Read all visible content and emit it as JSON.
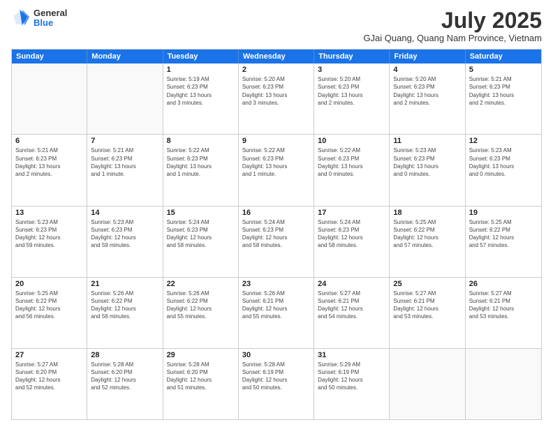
{
  "logo": {
    "general": "General",
    "blue": "Blue"
  },
  "header": {
    "title": "July 2025",
    "subtitle": "GJai Quang, Quang Nam Province, Vietnam"
  },
  "weekdays": [
    "Sunday",
    "Monday",
    "Tuesday",
    "Wednesday",
    "Thursday",
    "Friday",
    "Saturday"
  ],
  "rows": [
    [
      {
        "day": "",
        "info": ""
      },
      {
        "day": "",
        "info": ""
      },
      {
        "day": "1",
        "info": "Sunrise: 5:19 AM\nSunset: 6:23 PM\nDaylight: 13 hours\nand 3 minutes."
      },
      {
        "day": "2",
        "info": "Sunrise: 5:20 AM\nSunset: 6:23 PM\nDaylight: 13 hours\nand 3 minutes."
      },
      {
        "day": "3",
        "info": "Sunrise: 5:20 AM\nSunset: 6:23 PM\nDaylight: 13 hours\nand 2 minutes."
      },
      {
        "day": "4",
        "info": "Sunrise: 5:20 AM\nSunset: 6:23 PM\nDaylight: 13 hours\nand 2 minutes."
      },
      {
        "day": "5",
        "info": "Sunrise: 5:21 AM\nSunset: 6:23 PM\nDaylight: 13 hours\nand 2 minutes."
      }
    ],
    [
      {
        "day": "6",
        "info": "Sunrise: 5:21 AM\nSunset: 6:23 PM\nDaylight: 13 hours\nand 2 minutes."
      },
      {
        "day": "7",
        "info": "Sunrise: 5:21 AM\nSunset: 6:23 PM\nDaylight: 13 hours\nand 1 minute."
      },
      {
        "day": "8",
        "info": "Sunrise: 5:22 AM\nSunset: 6:23 PM\nDaylight: 13 hours\nand 1 minute."
      },
      {
        "day": "9",
        "info": "Sunrise: 5:22 AM\nSunset: 6:23 PM\nDaylight: 13 hours\nand 1 minute."
      },
      {
        "day": "10",
        "info": "Sunrise: 5:22 AM\nSunset: 6:23 PM\nDaylight: 13 hours\nand 0 minutes."
      },
      {
        "day": "11",
        "info": "Sunrise: 5:23 AM\nSunset: 6:23 PM\nDaylight: 13 hours\nand 0 minutes."
      },
      {
        "day": "12",
        "info": "Sunrise: 5:23 AM\nSunset: 6:23 PM\nDaylight: 13 hours\nand 0 minutes."
      }
    ],
    [
      {
        "day": "13",
        "info": "Sunrise: 5:23 AM\nSunset: 6:23 PM\nDaylight: 12 hours\nand 59 minutes."
      },
      {
        "day": "14",
        "info": "Sunrise: 5:23 AM\nSunset: 6:23 PM\nDaylight: 12 hours\nand 59 minutes."
      },
      {
        "day": "15",
        "info": "Sunrise: 5:24 AM\nSunset: 6:23 PM\nDaylight: 12 hours\nand 58 minutes."
      },
      {
        "day": "16",
        "info": "Sunrise: 5:24 AM\nSunset: 6:23 PM\nDaylight: 12 hours\nand 58 minutes."
      },
      {
        "day": "17",
        "info": "Sunrise: 5:24 AM\nSunset: 6:23 PM\nDaylight: 12 hours\nand 58 minutes."
      },
      {
        "day": "18",
        "info": "Sunrise: 5:25 AM\nSunset: 6:22 PM\nDaylight: 12 hours\nand 57 minutes."
      },
      {
        "day": "19",
        "info": "Sunrise: 5:25 AM\nSunset: 6:22 PM\nDaylight: 12 hours\nand 57 minutes."
      }
    ],
    [
      {
        "day": "20",
        "info": "Sunrise: 5:25 AM\nSunset: 6:22 PM\nDaylight: 12 hours\nand 56 minutes."
      },
      {
        "day": "21",
        "info": "Sunrise: 5:26 AM\nSunset: 6:22 PM\nDaylight: 12 hours\nand 56 minutes."
      },
      {
        "day": "22",
        "info": "Sunrise: 5:26 AM\nSunset: 6:22 PM\nDaylight: 12 hours\nand 55 minutes."
      },
      {
        "day": "23",
        "info": "Sunrise: 5:26 AM\nSunset: 6:21 PM\nDaylight: 12 hours\nand 55 minutes."
      },
      {
        "day": "24",
        "info": "Sunrise: 5:27 AM\nSunset: 6:21 PM\nDaylight: 12 hours\nand 54 minutes."
      },
      {
        "day": "25",
        "info": "Sunrise: 5:27 AM\nSunset: 6:21 PM\nDaylight: 12 hours\nand 53 minutes."
      },
      {
        "day": "26",
        "info": "Sunrise: 5:27 AM\nSunset: 6:21 PM\nDaylight: 12 hours\nand 53 minutes."
      }
    ],
    [
      {
        "day": "27",
        "info": "Sunrise: 5:27 AM\nSunset: 6:20 PM\nDaylight: 12 hours\nand 52 minutes."
      },
      {
        "day": "28",
        "info": "Sunrise: 5:28 AM\nSunset: 6:20 PM\nDaylight: 12 hours\nand 52 minutes."
      },
      {
        "day": "29",
        "info": "Sunrise: 5:28 AM\nSunset: 6:20 PM\nDaylight: 12 hours\nand 51 minutes."
      },
      {
        "day": "30",
        "info": "Sunrise: 5:28 AM\nSunset: 6:19 PM\nDaylight: 12 hours\nand 50 minutes."
      },
      {
        "day": "31",
        "info": "Sunrise: 5:29 AM\nSunset: 6:19 PM\nDaylight: 12 hours\nand 50 minutes."
      },
      {
        "day": "",
        "info": ""
      },
      {
        "day": "",
        "info": ""
      }
    ]
  ]
}
